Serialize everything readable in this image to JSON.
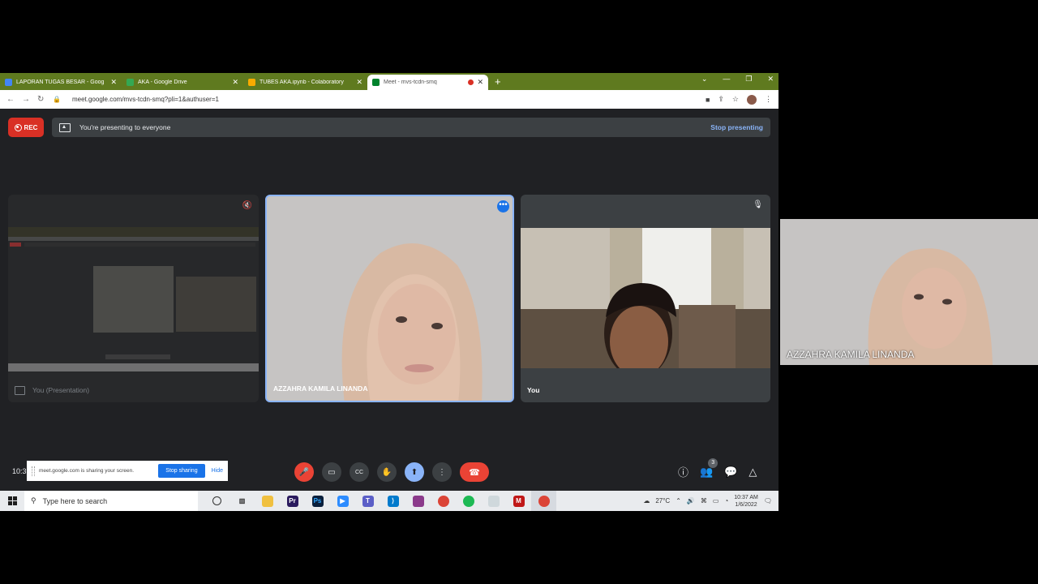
{
  "browser": {
    "tabs": [
      {
        "title": "LAPORAN TUGAS BESAR - Goog",
        "icon_color": "#4285f4",
        "width": 150
      },
      {
        "title": "AKA - Google Drive",
        "icon_color": "#34a853",
        "width": 150
      },
      {
        "title": "TUBES AKA.ipynb - Colaboratory",
        "icon_color": "#f9ab00",
        "width": 153
      },
      {
        "title": "Meet - mvs-tcdn-smq",
        "icon_color": "#00832d",
        "width": 149
      }
    ],
    "active_tab": 3,
    "new_tab": "+",
    "url": "meet.google.com/mvs-tcdn-smq?pli=1&authuser=1"
  },
  "meet": {
    "rec_label": "REC",
    "presenting_message": "You're presenting to everyone",
    "stop_presenting": "Stop presenting",
    "tiles": [
      {
        "name": "You (Presentation)"
      },
      {
        "name": "AZZAHRA KAMILA LINANDA"
      },
      {
        "name": "You"
      }
    ],
    "selfview_name": "AZZAHRA KAMILA LINANDA",
    "clock": "10:3",
    "people_count": "3"
  },
  "share_notice": {
    "message": "meet.google.com is sharing your screen.",
    "stop_button": "Stop sharing",
    "hide_button": "Hide"
  },
  "taskbar": {
    "search_placeholder": "Type here to search",
    "temperature": "27°C",
    "time": "10:37 AM",
    "date": "1/6/2022"
  }
}
